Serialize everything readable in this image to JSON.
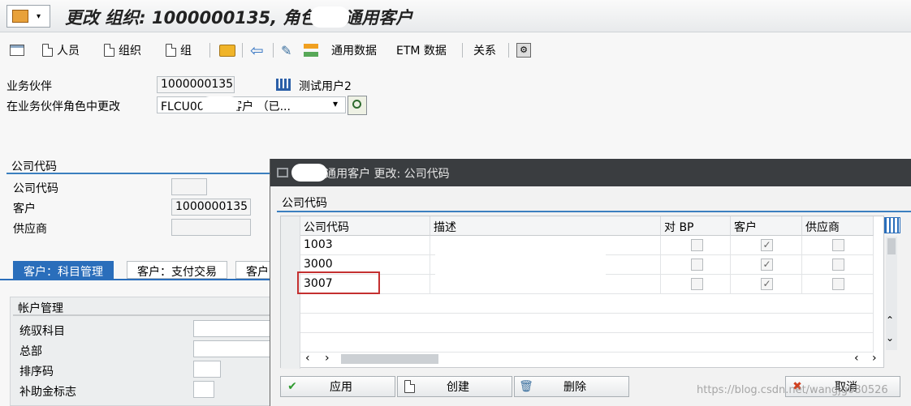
{
  "title": "更改 组织: 1000000135, 角色 (        )通用客户",
  "toolbar": {
    "person": "人员",
    "org": "组织",
    "group": "组",
    "general_data": "通用数据",
    "etm_data": "ETM 数据",
    "relations": "关系"
  },
  "header": {
    "bp_label": "业务伙伴",
    "bp_value": "1000000135",
    "bp_name": "测试用户2",
    "role_label": "在业务伙伴角色中更改",
    "role_value": "FLCU00         通用客户 （已..."
  },
  "company_section": {
    "title": "公司代码",
    "company_code_label": "公司代码",
    "company_code_value": "",
    "customer_label": "客户",
    "customer_value": "1000000135",
    "vendor_label": "供应商",
    "vendor_value": ""
  },
  "tabs": [
    {
      "label": "客户：科目管理",
      "active": true
    },
    {
      "label": "客户：支付交易",
      "active": false
    },
    {
      "label": "客户",
      "active": false
    }
  ],
  "account_section": {
    "title": "帐户管理",
    "fields": [
      "统驭科目",
      "总部",
      "排序码",
      "补助金标志"
    ]
  },
  "dialog": {
    "title": "        )通用客户 更改: 公司代码",
    "section_title": "公司代码",
    "columns": [
      "公司代码",
      "描述",
      "对 BP",
      "客户",
      "供应商"
    ],
    "rows": [
      {
        "code": "1003",
        "desc": "",
        "bp": false,
        "customer": true,
        "vendor": false
      },
      {
        "code": "3000",
        "desc": "",
        "bp": false,
        "customer": true,
        "vendor": false
      },
      {
        "code": "3007",
        "desc": "",
        "bp": false,
        "customer": true,
        "vendor": false
      }
    ],
    "buttons": {
      "apply": "应用",
      "create": "创建",
      "delete": "删除",
      "cancel": "取消"
    }
  },
  "watermark": "https://blog.csdn.net/wangjg080526"
}
